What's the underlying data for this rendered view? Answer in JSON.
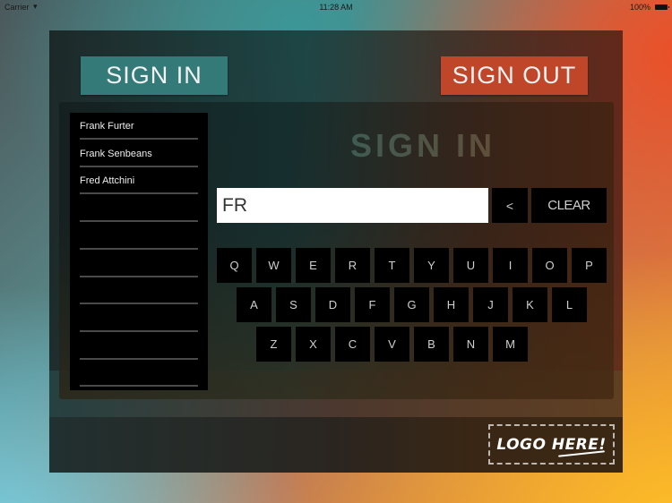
{
  "status_bar": {
    "carrier": "Carrier",
    "wifi_icon": "wifi-icon",
    "time": "11:28 AM",
    "battery_pct": "100%",
    "battery_icon": "battery-icon"
  },
  "header": {
    "sign_in_label": "SIGN IN",
    "sign_out_label": "SIGN OUT",
    "sign_in_color": "#347a78",
    "sign_out_color": "#c0462a"
  },
  "main": {
    "heading": "SIGN IN",
    "search_value": "FR",
    "backspace_label": "<",
    "clear_label": "CLEAR"
  },
  "names": [
    "Frank Furter",
    "Frank Senbeans",
    "Fred Attchini",
    "",
    "",
    "",
    "",
    "",
    "",
    ""
  ],
  "keyboard": {
    "rows": [
      [
        "Q",
        "W",
        "E",
        "R",
        "T",
        "Y",
        "U",
        "I",
        "O",
        "P"
      ],
      [
        "A",
        "S",
        "D",
        "F",
        "G",
        "H",
        "J",
        "K",
        "L"
      ],
      [
        "Z",
        "X",
        "C",
        "V",
        "B",
        "N",
        "M"
      ]
    ]
  },
  "footer": {
    "logo_text": "LOGO HERE!"
  }
}
